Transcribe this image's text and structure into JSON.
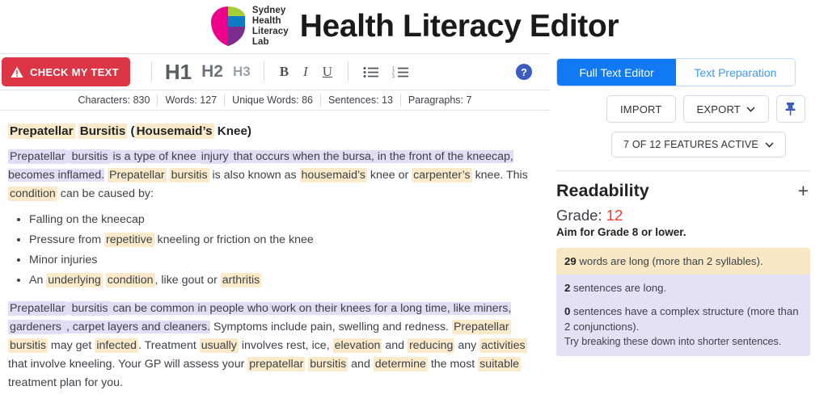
{
  "header": {
    "logo_name": "sydney-health-literacy-lab-logo",
    "logo_lines": [
      "Sydney",
      "Health",
      "Literacy",
      "Lab"
    ],
    "title": "Health Literacy Editor"
  },
  "toolbar": {
    "check_button": "CHECK MY TEXT",
    "warning_icon": "warning-triangle-icon",
    "h1": "H1",
    "h2": "H2",
    "h3": "H3",
    "bold": "B",
    "italic": "I",
    "underline": "U",
    "bullet_list_icon": "bullet-list-icon",
    "numbered_list_icon": "numbered-list-icon",
    "help_icon": "help-circle-icon",
    "help_glyph": "?"
  },
  "stats": [
    "Characters: 830",
    "Words: 127",
    "Unique Words: 86",
    "Sentences: 13",
    "Paragraphs: 7"
  ],
  "document": {
    "heading": [
      {
        "t": "Prepatellar",
        "h": "word"
      },
      {
        "t": " ",
        "h": "none"
      },
      {
        "t": "Bursitis",
        "h": "word"
      },
      {
        "t": " (",
        "h": "none"
      },
      {
        "t": "Housemaid’s",
        "h": "word"
      },
      {
        "t": " Knee)",
        "h": "none"
      }
    ],
    "para1": [
      {
        "t": "Prepatellar",
        "h": "word-sent"
      },
      {
        "t": " ",
        "h": "sent"
      },
      {
        "t": "bursitis",
        "h": "word-sent"
      },
      {
        "t": " is a type of knee ",
        "h": "sent"
      },
      {
        "t": "injury",
        "h": "word-sent"
      },
      {
        "t": " that occurs when the bursa, in the front of the kneecap, becomes inflamed.",
        "h": "sent"
      },
      {
        "t": " ",
        "h": "none"
      },
      {
        "t": "Prepatellar",
        "h": "word"
      },
      {
        "t": " ",
        "h": "none"
      },
      {
        "t": "bursitis",
        "h": "word"
      },
      {
        "t": " is also known as ",
        "h": "none"
      },
      {
        "t": "housemaid’s",
        "h": "word"
      },
      {
        "t": " knee or ",
        "h": "none"
      },
      {
        "t": "carpenter’s",
        "h": "word"
      },
      {
        "t": " knee. This ",
        "h": "none"
      },
      {
        "t": "condition",
        "h": "word"
      },
      {
        "t": " can be caused by:",
        "h": "none"
      }
    ],
    "bullets": [
      [
        {
          "t": "Falling on the kneecap",
          "h": "none"
        }
      ],
      [
        {
          "t": "Pressure from ",
          "h": "none"
        },
        {
          "t": "repetitive",
          "h": "word"
        },
        {
          "t": " kneeling or friction on the knee",
          "h": "none"
        }
      ],
      [
        {
          "t": "Minor injuries",
          "h": "none"
        }
      ],
      [
        {
          "t": "An ",
          "h": "none"
        },
        {
          "t": "underlying",
          "h": "word"
        },
        {
          "t": " ",
          "h": "none"
        },
        {
          "t": "condition",
          "h": "word"
        },
        {
          "t": ", like gout or ",
          "h": "none"
        },
        {
          "t": "arthritis",
          "h": "word"
        }
      ]
    ],
    "para2": [
      {
        "t": "Prepatellar",
        "h": "word-sent"
      },
      {
        "t": " ",
        "h": "sent"
      },
      {
        "t": "bursitis",
        "h": "word-sent"
      },
      {
        "t": " can be common in people who work on their knees for a long time, like miners, ",
        "h": "sent"
      },
      {
        "t": "gardeners",
        "h": "word-sent"
      },
      {
        "t": " , carpet layers and cleaners.",
        "h": "sent"
      },
      {
        "t": " Symptoms include pain, swelling and redness. ",
        "h": "none"
      },
      {
        "t": "Prepatellar",
        "h": "word"
      },
      {
        "t": " ",
        "h": "none"
      },
      {
        "t": "bursitis",
        "h": "word"
      },
      {
        "t": " may get ",
        "h": "none"
      },
      {
        "t": "infected",
        "h": "word"
      },
      {
        "t": ". Treatment ",
        "h": "none"
      },
      {
        "t": "usually",
        "h": "word"
      },
      {
        "t": " involves rest, ice, ",
        "h": "none"
      },
      {
        "t": "elevation",
        "h": "word"
      },
      {
        "t": " and ",
        "h": "none"
      },
      {
        "t": "reducing",
        "h": "word"
      },
      {
        "t": " any ",
        "h": "none"
      },
      {
        "t": "activities",
        "h": "word"
      },
      {
        "t": " that involve kneeling. Your GP will assess your ",
        "h": "none"
      },
      {
        "t": "prepatellar",
        "h": "word"
      },
      {
        "t": " ",
        "h": "none"
      },
      {
        "t": "bursitis",
        "h": "word"
      },
      {
        "t": " and ",
        "h": "none"
      },
      {
        "t": "determine",
        "h": "word"
      },
      {
        "t": " the most ",
        "h": "none"
      },
      {
        "t": "suitable",
        "h": "word"
      },
      {
        "t": " treatment plan for you.",
        "h": "none"
      }
    ]
  },
  "panel": {
    "tab_full_text_editor": "Full Text Editor",
    "tab_text_preparation": "Text Preparation",
    "import_label": "IMPORT",
    "export_label": "EXPORT",
    "export_chevron": "⌄",
    "pin_icon": "pin-icon",
    "features_label": "7 OF 12 FEATURES ACTIVE",
    "features_chevron": "⌄"
  },
  "readability": {
    "title": "Readability",
    "expand_glyph": "+",
    "grade_label": "Grade:",
    "grade_value": "12",
    "aim_text": "Aim for Grade 8 or lower.",
    "long_words_count": "29",
    "long_words_text": " words are long (more than 2 syllables).",
    "long_sentences_count": "2",
    "long_sentences_text": " sentences are long.",
    "complex_count": "0",
    "complex_text": " sentences have a complex structure (more than 2 conjunctions).",
    "tip_text": "Try breaking these down into shorter sentences."
  },
  "colors": {
    "accent_red": "#dc3545",
    "accent_blue": "#1279f4",
    "word_highlight": "#fbeaca",
    "sentence_highlight": "#e2ddf4",
    "grade_red": "#f8392c"
  }
}
